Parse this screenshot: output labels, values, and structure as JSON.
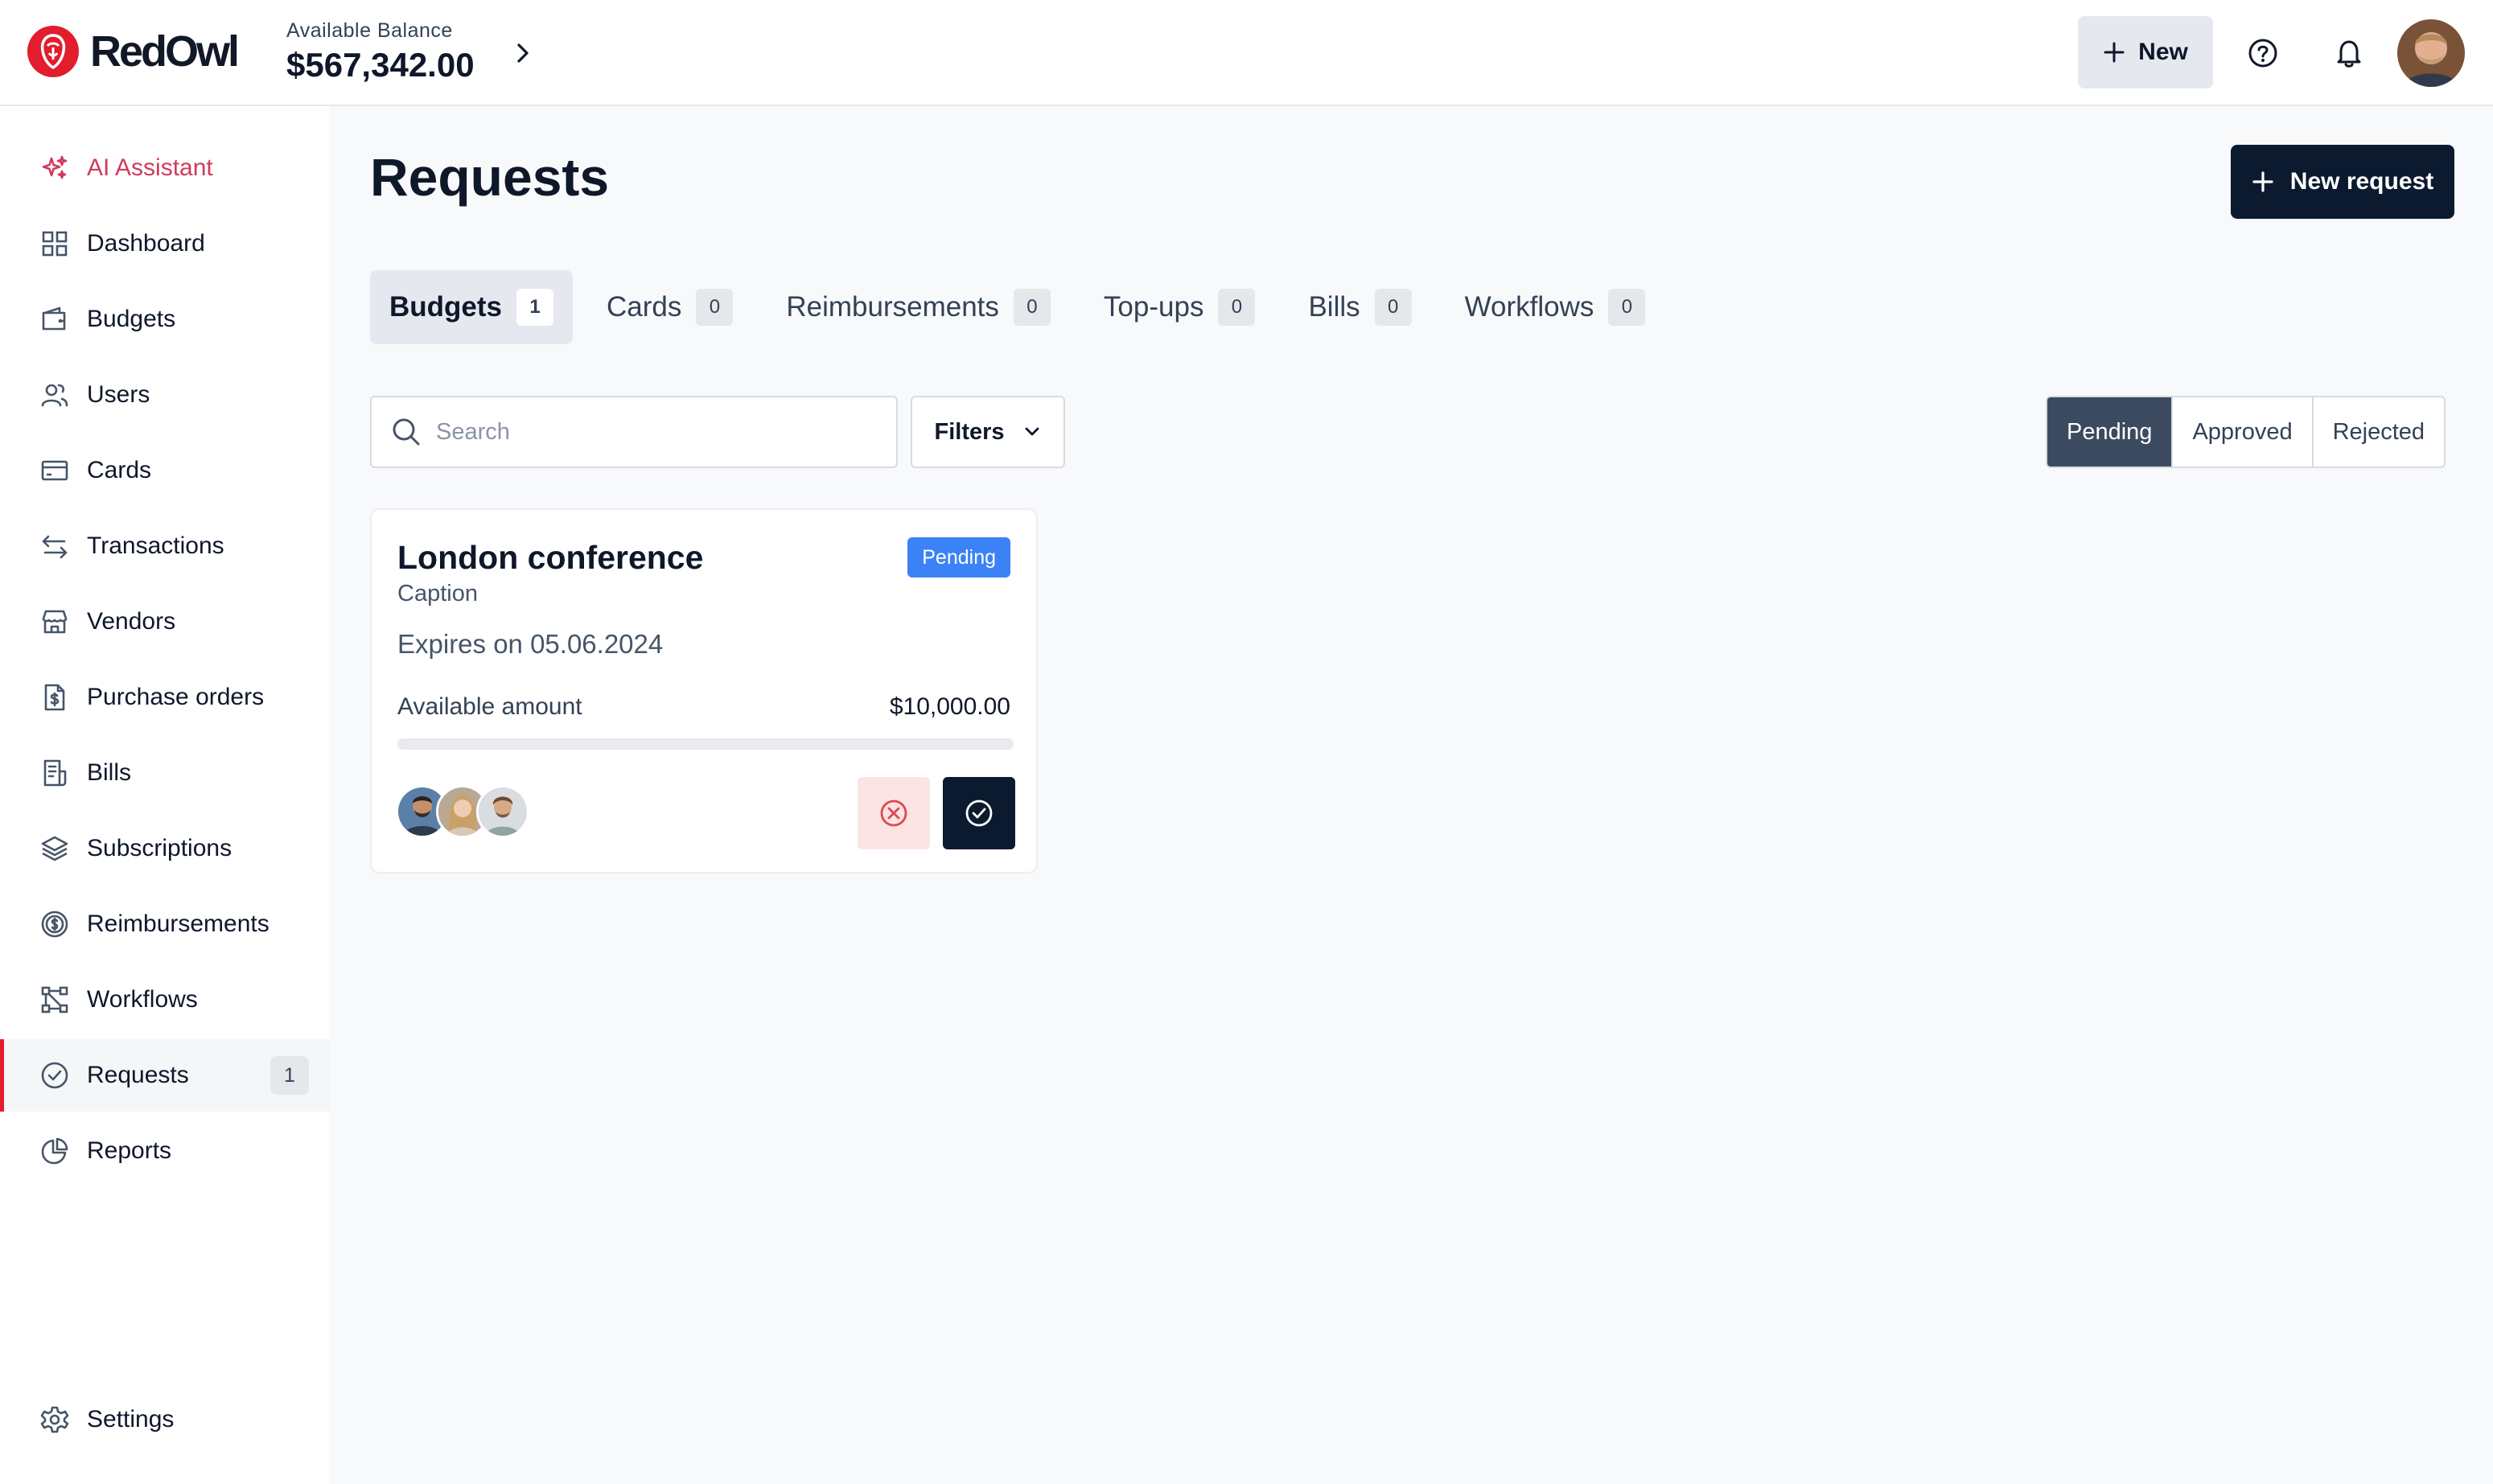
{
  "app": {
    "brand": "RedOwl",
    "brand_color": "#e11d2e"
  },
  "header": {
    "balance_label": "Available Balance",
    "balance_value": "$567,342.00",
    "new_label": "New"
  },
  "sidebar": {
    "items": [
      {
        "label": "AI Assistant",
        "icon": "sparkles-icon"
      },
      {
        "label": "Dashboard",
        "icon": "grid-icon"
      },
      {
        "label": "Budgets",
        "icon": "wallet-icon"
      },
      {
        "label": "Users",
        "icon": "users-icon"
      },
      {
        "label": "Cards",
        "icon": "credit-card-icon"
      },
      {
        "label": "Transactions",
        "icon": "arrows-left-right-icon"
      },
      {
        "label": "Vendors",
        "icon": "store-icon"
      },
      {
        "label": "Purchase orders",
        "icon": "document-dollar-icon"
      },
      {
        "label": "Bills",
        "icon": "receipt-icon"
      },
      {
        "label": "Subscriptions",
        "icon": "layers-icon"
      },
      {
        "label": "Reimbursements",
        "icon": "coin-dollar-icon"
      },
      {
        "label": "Workflows",
        "icon": "workflow-icon"
      },
      {
        "label": "Requests",
        "icon": "check-circle-icon",
        "count": "1",
        "active": true
      },
      {
        "label": "Reports",
        "icon": "pie-chart-icon"
      }
    ],
    "settings_label": "Settings"
  },
  "main": {
    "title": "Requests",
    "new_request_label": "New request",
    "tabs": [
      {
        "label": "Budgets",
        "count": "1",
        "active": true
      },
      {
        "label": "Cards",
        "count": "0"
      },
      {
        "label": "Reimbursements",
        "count": "0"
      },
      {
        "label": "Top-ups",
        "count": "0"
      },
      {
        "label": "Bills",
        "count": "0"
      },
      {
        "label": "Workflows",
        "count": "0"
      }
    ],
    "search": {
      "placeholder": "Search",
      "value": ""
    },
    "filters_label": "Filters",
    "status_filter": {
      "options": [
        "Pending",
        "Approved",
        "Rejected"
      ],
      "selected": "Pending"
    },
    "card": {
      "title": "London conference",
      "status": "Pending",
      "caption": "Caption",
      "expires": "Expires on 05.06.2024",
      "amount_label": "Available amount",
      "amount_value": "$10,000.00",
      "progress_fraction": 0
    }
  }
}
